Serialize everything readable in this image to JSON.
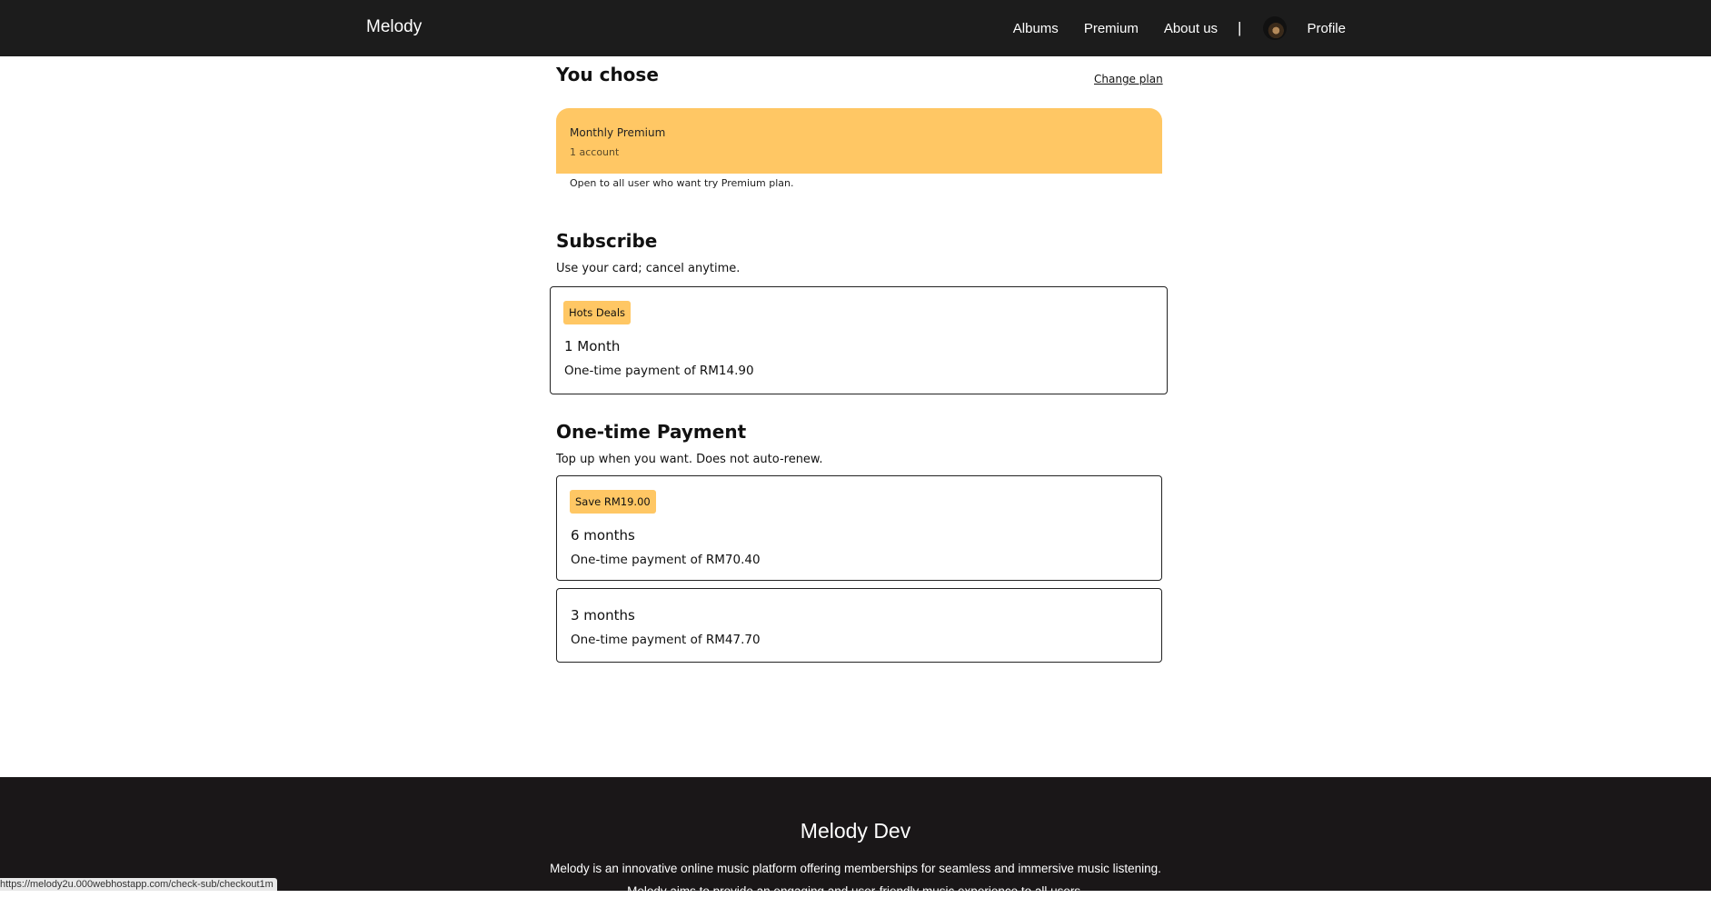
{
  "nav": {
    "brand": "Melody",
    "links": [
      "Albums",
      "Premium",
      "About us"
    ],
    "separator": "|",
    "profile_label": "Profile"
  },
  "chosen": {
    "title": "You chose",
    "change_plan": "Change plan",
    "plan_name": "Monthly Premium",
    "accounts": "1 account",
    "note": "Open to all user who want try Premium plan."
  },
  "subscribe": {
    "title": "Subscribe",
    "subtitle": "Use your card; cancel anytime.",
    "option": {
      "badge": "Hots Deals",
      "duration": "1 Month",
      "price": "One-time payment of RM14.90"
    }
  },
  "onetime": {
    "title": "One-time Payment",
    "subtitle": "Top up when you want. Does not auto-renew.",
    "options": [
      {
        "badge": "Save RM19.00",
        "duration": "6 months",
        "price": "One-time payment of RM70.40"
      },
      {
        "badge": "",
        "duration": "3 months",
        "price": "One-time payment of RM47.70"
      }
    ]
  },
  "footer": {
    "title": "Melody Dev",
    "line1": "Melody is an innovative online music platform offering memberships for seamless and immersive music listening.",
    "line2": "Melody aims to provide an engaging and user-friendly music experience to all users."
  },
  "status_bar": {
    "url": "https://melody2u.000webhostapp.com/check-sub/checkout1m"
  },
  "colors": {
    "nav_bg": "#1c1c1c",
    "accent": "#ffc764",
    "footer_bg": "#1a1718"
  }
}
